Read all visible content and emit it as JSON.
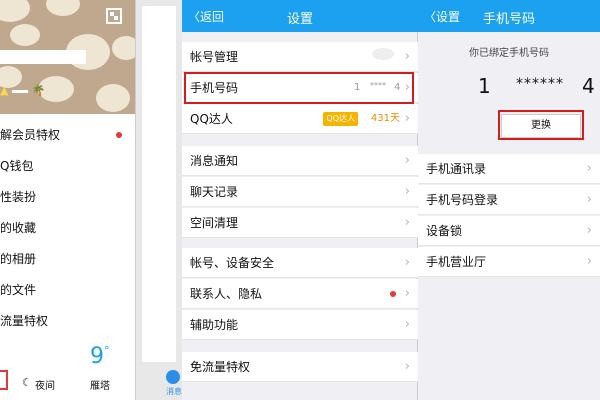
{
  "drawer": {
    "vip_label": "解会员特权",
    "menu": [
      "解会员特权",
      "Q钱包",
      "性装扮",
      "的收藏",
      "的相册",
      "的文件",
      "流量特权"
    ],
    "weather_temp": "9",
    "weather_deg": "°",
    "night_label": "夜间",
    "city_label": "雁塔",
    "moon_glyph": "☾",
    "palm_glyph": "🌴"
  },
  "bg_screen": {
    "tab_label": "消息"
  },
  "settings": {
    "back_label": "〈返回",
    "title": "设置",
    "account_mgmt": "帐号管理",
    "phone_label": "手机号码",
    "phone_start": "1",
    "phone_mask": "****",
    "phone_end": "4",
    "qq_expert": "QQ达人",
    "qq_badge": "QQ达人",
    "qq_days": "431天",
    "notifications": "消息通知",
    "chat_history": "聊天记录",
    "storage_cleanup": "空间清理",
    "account_security": "帐号、设备安全",
    "contacts_privacy": "联系人、隐私",
    "accessibility": "辅助功能",
    "free_data": "免流量特权",
    "chevron": "›"
  },
  "phone": {
    "back_label": "〈设置",
    "title": "手机号码",
    "bound_text": "你已绑定手机号码",
    "num_start": "1",
    "num_mask": "******",
    "num_end": "4",
    "change_label": "更换",
    "contacts": "手机通讯录",
    "login": "手机号码登录",
    "device_lock": "设备锁",
    "hall": "手机营业厅"
  },
  "colors": {
    "header": "#1ba1ef",
    "highlight": "#d41c1c",
    "badge_dot": "#e53935"
  }
}
